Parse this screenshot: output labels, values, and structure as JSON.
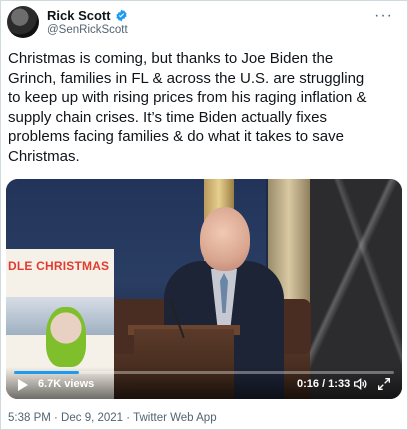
{
  "author": {
    "name": "Rick Scott",
    "handle": "@SenRickScott",
    "verified": true
  },
  "tweet": {
    "text": "Christmas is coming, but thanks to Joe Biden the\nGrinch, families in FL & across the U.S. are struggling\nto keep up with rising prices from his raging inflation &\nsupply chain crises. It’s time Biden actually fixes\nproblems facing families & do what it takes to save\nChristmas."
  },
  "video": {
    "thumbnail_text": "DLE CHRISTMAS",
    "views": "6.7K views",
    "time": "0:16 / 1:33",
    "progress": 0.17
  },
  "meta": {
    "timestamp": "5:38 PM · Dec 9, 2021 · Twitter Web App"
  },
  "colors": {
    "accent": "#1d9bf0"
  },
  "icons": {
    "more": "more-icon",
    "verified": "verified-badge-icon",
    "play": "play-icon",
    "volume": "volume-icon",
    "fullscreen": "fullscreen-icon"
  }
}
